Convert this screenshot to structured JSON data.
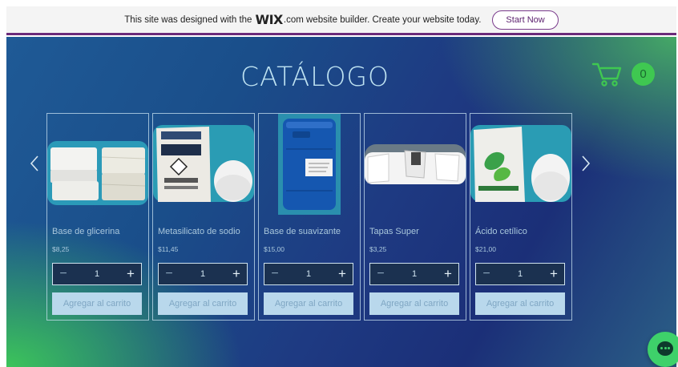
{
  "banner": {
    "text_before": "This site was designed with the",
    "logo": "WIX",
    "text_after": ".com website builder. Create your website today.",
    "cta_label": "Start Now"
  },
  "page": {
    "title": "CATÁLOGO",
    "cart_count": "0"
  },
  "colors": {
    "accent_green": "#3fc851",
    "title_color": "#bfe3f2",
    "button_bg": "#b9d8ec"
  },
  "icons": {
    "cart": "shopping-cart-icon",
    "prev": "chevron-left-icon",
    "next": "chevron-right-icon",
    "chat": "chat-icon"
  },
  "products": [
    {
      "name": "Base de glicerina",
      "price": "$8,25",
      "qty": "1",
      "add_label": "Agregar al carrito"
    },
    {
      "name": "Metasilicato de sodio",
      "price": "$11,45",
      "qty": "1",
      "add_label": "Agregar al carrito"
    },
    {
      "name": "Base de suavizante",
      "price": "$15,00",
      "qty": "1",
      "add_label": "Agregar al carrito"
    },
    {
      "name": "Tapas Super",
      "price": "$3,25",
      "qty": "1",
      "add_label": "Agregar al carrito"
    },
    {
      "name": "Ácido cetílico",
      "price": "$21,00",
      "qty": "1",
      "add_label": "Agregar al carrito"
    }
  ],
  "qty_controls": {
    "minus": "−",
    "plus": "+"
  }
}
